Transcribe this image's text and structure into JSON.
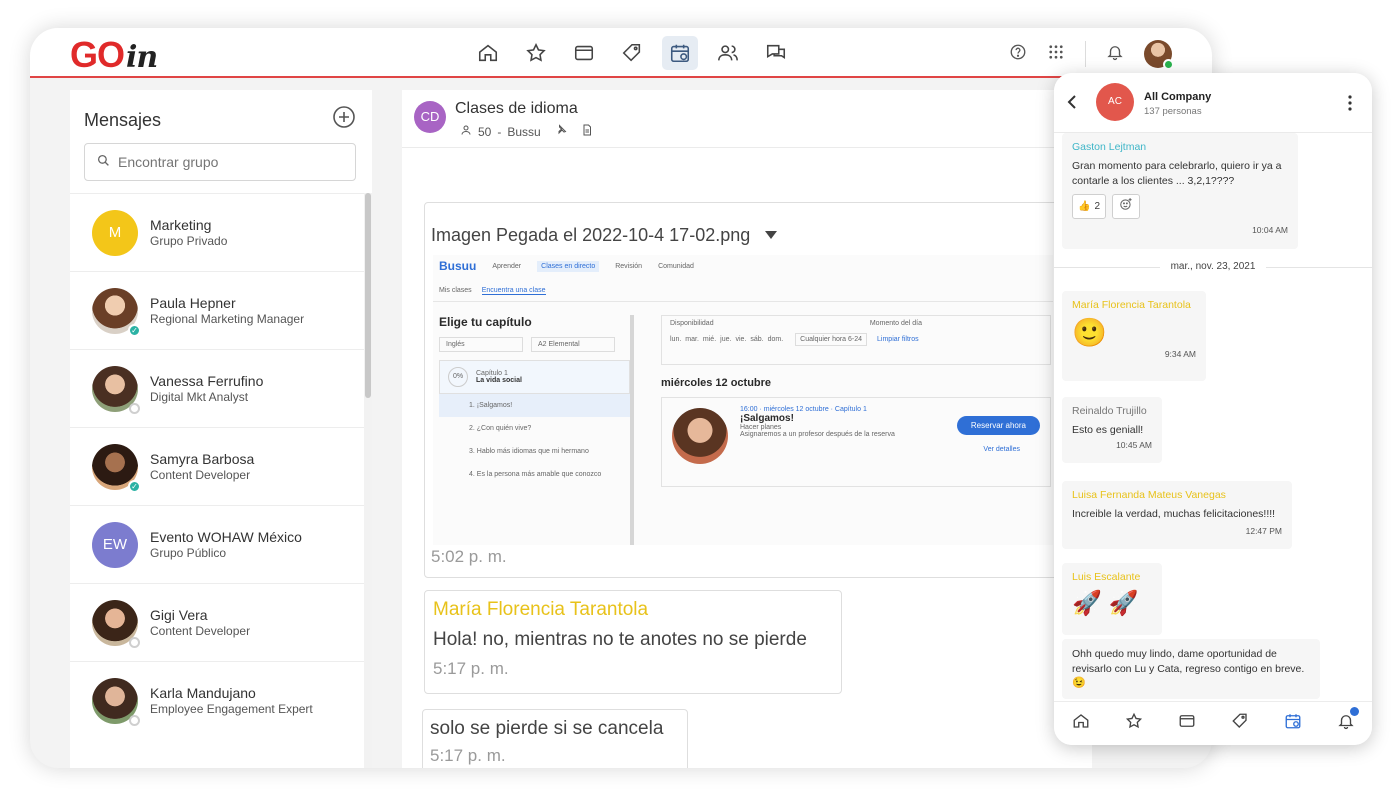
{
  "brand": {
    "logo_go": "GO",
    "logo_in": "in"
  },
  "topnav": {
    "icons": [
      "home-icon",
      "star-icon",
      "wallet-icon",
      "tag-icon",
      "calendar-icon",
      "people-icon",
      "chat-icon"
    ],
    "active": "calendar-icon",
    "right_icons": [
      "help-icon",
      "apps-grid-icon",
      "bell-icon"
    ]
  },
  "sidebar": {
    "title": "Mensajes",
    "search_placeholder": "Encontrar grupo",
    "contacts": [
      {
        "initials": "M",
        "name": "Marketing",
        "subtitle": "Grupo Privado",
        "color": "#f3c619"
      },
      {
        "name": "Paula Hepner",
        "subtitle": "Regional Marketing Manager",
        "status": "online"
      },
      {
        "name": "Vanessa Ferrufino",
        "subtitle": "Digital Mkt Analyst",
        "status": "offline"
      },
      {
        "name": "Samyra Barbosa",
        "subtitle": "Content Developer",
        "status": "online"
      },
      {
        "initials": "EW",
        "name": "Evento WOHAW México",
        "subtitle": "Grupo Público",
        "color": "#7c7ccf"
      },
      {
        "name": "Gigi Vera",
        "subtitle": "Content Developer",
        "status": "offline"
      },
      {
        "name": "Karla Mandujano",
        "subtitle": "Employee Engagement Expert",
        "status": "offline"
      }
    ]
  },
  "chat": {
    "initials": "CD",
    "title": "Clases de idioma",
    "members": "50",
    "separator": "-",
    "app": "Bussu",
    "messages": [
      {
        "type": "image",
        "title": "Imagen Pegada el 2022-10-4 17-02.png",
        "time": "5:02 p. m."
      },
      {
        "author": "María Florencia Tarantola",
        "text": "Hola! no, mientras no te anotes no se pierde",
        "time": "5:17 p. m."
      },
      {
        "text": "solo se pierde si se cancela",
        "time": "5:17 p. m."
      }
    ],
    "embed": {
      "logo": "Busuu",
      "tabs": [
        "Aprender",
        "Clases en directo",
        "Revisión",
        "Comunidad"
      ],
      "subtabs": [
        "Mis clases",
        "Encuentra una clase"
      ],
      "heading": "Elige tu capítulo",
      "language": "Inglés",
      "level": "A2 Elemental",
      "progress": "0%",
      "chapter": "Capítulo 1",
      "chapter_name": "La vida social",
      "lessons": [
        "1. ¡Salgamos!",
        "2. ¿Con quién vive?",
        "3. Hablo más idiomas que mi hermano",
        "4. Es la persona más amable que conozco"
      ],
      "availability_label": "Disponibilidad",
      "days": [
        "lun.",
        "mar.",
        "mié.",
        "jue.",
        "vie.",
        "sáb.",
        "dom."
      ],
      "moment_label": "Momento del día",
      "moment_value": "Cualquier hora 6-24",
      "clear_filters": "Limpiar filtros",
      "date_heading": "miércoles 12 octubre",
      "class_meta": "16:00 · miércoles 12 octubre · Capítulo 1",
      "class_title": "¡Salgamos!",
      "class_sub": "Hacer planes",
      "class_note": "Asignaremos a un profesor después de la reserva",
      "book_button": "Reservar ahora",
      "details_link": "Ver detalles"
    }
  },
  "phone": {
    "initials": "AC",
    "title": "All Company",
    "subtitle": "137 personas",
    "date_divider": "mar., nov. 23, 2021",
    "messages": [
      {
        "author": "Gaston Lejtman",
        "author_color": "#3fb6c8",
        "text": "Gran momento para celebrarlo, quiero ir ya a contarle a los clientes ... 3,2,1????",
        "reaction_count": "2",
        "time": "10:04 AM"
      },
      {
        "author": "María Florencia Tarantola",
        "author_color": "#e8c21a",
        "emoji": "🙂",
        "time": "9:34 AM"
      },
      {
        "author": "Reinaldo Trujillo",
        "author_color": "#777777",
        "text": "Esto es geniall!",
        "time": "10:45 AM"
      },
      {
        "author": "Luisa Fernanda Mateus Vanegas",
        "author_color": "#e8c21a",
        "text": "Increible la verdad, muchas felicitaciones!!!!",
        "time": "12:47 PM"
      },
      {
        "author": "Luis Escalante",
        "author_color": "#e8c21a",
        "emoji": "🚀 🚀"
      },
      {
        "text": "Ohh quedo muy lindo, dame oportunidad de revisarlo con Lu y Cata, regreso contigo en breve."
      }
    ]
  }
}
